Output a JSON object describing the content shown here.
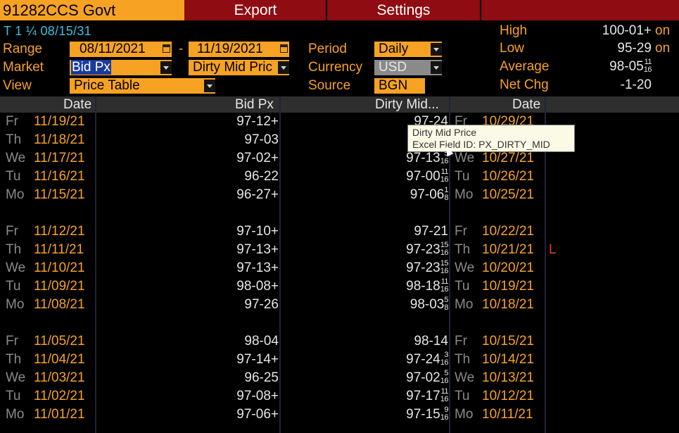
{
  "header": {
    "ticker": "91282CCS Govt",
    "export_label": "Export",
    "settings_label": "Settings"
  },
  "security_line": "T 1 ¼ 08/15/31",
  "controls": {
    "range_label": "Range",
    "range_start": "08/11/2021",
    "range_dash": "-",
    "range_end": "11/19/2021",
    "market_label": "Market",
    "market_value": "Bid Px",
    "market_value2": "Dirty Mid Pric",
    "view_label": "View",
    "view_value": "Price Table",
    "period_label": "Period",
    "period_value": "Daily",
    "currency_label": "Currency",
    "currency_value": "USD",
    "source_label": "Source",
    "source_value": "BGN"
  },
  "stats": {
    "high_label": "High",
    "high_value": "100-01+",
    "high_on": "on",
    "low_label": "Low",
    "low_value": "95-29",
    "low_on": "on",
    "avg_label": "Average",
    "avg_value": "98-05",
    "avg_frac_num": "11",
    "avg_frac_den": "16",
    "netchg_label": "Net Chg",
    "netchg_value": "-1-20"
  },
  "table": {
    "headers": {
      "date": "Date",
      "bid": "Bid Px",
      "dirty": "Dirty Mid...",
      "date2": "Date"
    },
    "rows": [
      {
        "dow": "Fr",
        "date": "11/19/21",
        "bid": "97-12+",
        "dirty": "97-24",
        "fn": "",
        "fd": "",
        "dow2": "Fr",
        "date2": "10/29/21",
        "flag": ""
      },
      {
        "dow": "Th",
        "date": "11/18/21",
        "bid": "97-03",
        "dirty": "97",
        "fn": "",
        "fd": "",
        "dow2": "",
        "date2": "",
        "flag": ""
      },
      {
        "dow": "We",
        "date": "11/17/21",
        "bid": "97-02+",
        "dirty": "97-13",
        "fn": "5",
        "fd": "16",
        "dow2": "We",
        "date2": "10/27/21",
        "flag": ""
      },
      {
        "dow": "Tu",
        "date": "11/16/21",
        "bid": "96-22",
        "dirty": "97-00",
        "fn": "11",
        "fd": "16",
        "dow2": "Tu",
        "date2": "10/26/21",
        "flag": ""
      },
      {
        "dow": "Mo",
        "date": "11/15/21",
        "bid": "96-27+",
        "dirty": "97-06",
        "fn": "1",
        "fd": "8",
        "dow2": "Mo",
        "date2": "10/25/21",
        "flag": ""
      },
      {
        "dow": "Fr",
        "date": "11/12/21",
        "bid": "97-10+",
        "dirty": "97-21",
        "fn": "",
        "fd": "",
        "dow2": "Fr",
        "date2": "10/22/21",
        "flag": ""
      },
      {
        "dow": "Th",
        "date": "11/11/21",
        "bid": "97-13+",
        "dirty": "97-23",
        "fn": "15",
        "fd": "16",
        "dow2": "Th",
        "date2": "10/21/21",
        "flag": "L"
      },
      {
        "dow": "We",
        "date": "11/10/21",
        "bid": "97-13+",
        "dirty": "97-23",
        "fn": "15",
        "fd": "16",
        "dow2": "We",
        "date2": "10/20/21",
        "flag": ""
      },
      {
        "dow": "Tu",
        "date": "11/09/21",
        "bid": "98-08+",
        "dirty": "98-18",
        "fn": "11",
        "fd": "16",
        "dow2": "Tu",
        "date2": "10/19/21",
        "flag": ""
      },
      {
        "dow": "Mo",
        "date": "11/08/21",
        "bid": "97-26",
        "dirty": "98-03",
        "fn": "5",
        "fd": "8",
        "dow2": "Mo",
        "date2": "10/18/21",
        "flag": ""
      },
      {
        "dow": "Fr",
        "date": "11/05/21",
        "bid": "98-04",
        "dirty": "98-14",
        "fn": "",
        "fd": "",
        "dow2": "Fr",
        "date2": "10/15/21",
        "flag": ""
      },
      {
        "dow": "Th",
        "date": "11/04/21",
        "bid": "97-14+",
        "dirty": "97-24",
        "fn": "3",
        "fd": "16",
        "dow2": "Th",
        "date2": "10/14/21",
        "flag": ""
      },
      {
        "dow": "We",
        "date": "11/03/21",
        "bid": "96-25",
        "dirty": "97-02",
        "fn": "5",
        "fd": "16",
        "dow2": "We",
        "date2": "10/13/21",
        "flag": ""
      },
      {
        "dow": "Tu",
        "date": "11/02/21",
        "bid": "97-08+",
        "dirty": "97-17",
        "fn": "11",
        "fd": "16",
        "dow2": "Tu",
        "date2": "10/12/21",
        "flag": ""
      },
      {
        "dow": "Mo",
        "date": "11/01/21",
        "bid": "97-06+",
        "dirty": "97-15",
        "fn": "9",
        "fd": "16",
        "dow2": "Mo",
        "date2": "10/11/21",
        "flag": ""
      }
    ]
  },
  "tooltip": {
    "line1": "Dirty Mid Price",
    "line2": "Excel Field ID: PX_DIRTY_MID"
  }
}
